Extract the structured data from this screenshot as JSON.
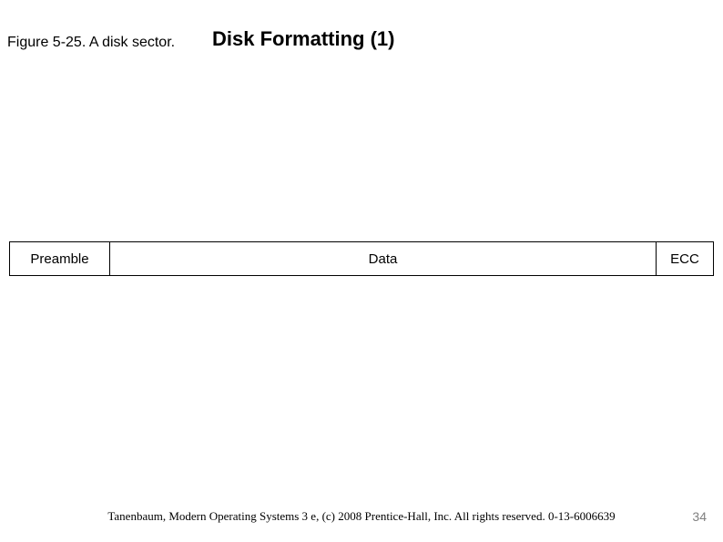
{
  "slide": {
    "title": "Disk Formatting (1)",
    "caption": "Figure 5-25. A disk sector."
  },
  "sector": {
    "cells": {
      "preamble": "Preamble",
      "data": "Data",
      "ecc": "ECC"
    }
  },
  "footer": {
    "citation": "Tanenbaum, Modern Operating Systems 3 e, (c) 2008 Prentice-Hall, Inc. All rights reserved. 0-13-6006639",
    "page": "34"
  }
}
